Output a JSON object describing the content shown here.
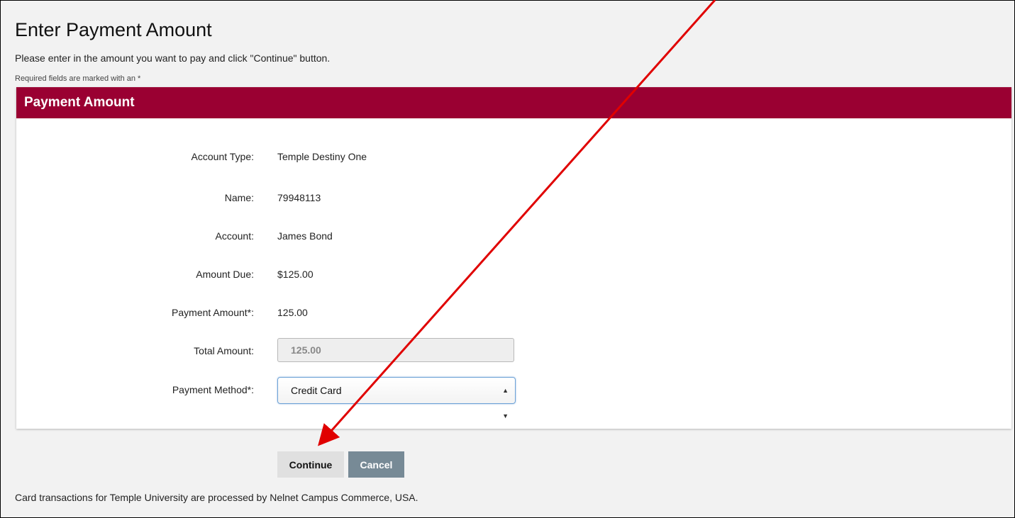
{
  "page": {
    "title": "Enter Payment Amount",
    "instructions": "Please enter in the amount you want to pay and click \"Continue\" button.",
    "required_note": "Required fields are marked with an *"
  },
  "panel": {
    "header": "Payment Amount",
    "fields": {
      "account_type": {
        "label": "Account Type:",
        "value": "Temple Destiny One"
      },
      "name": {
        "label": "Name:",
        "value": "79948113"
      },
      "account": {
        "label": "Account:",
        "value": "James Bond"
      },
      "amount_due": {
        "label": "Amount Due:",
        "value": "$125.00"
      },
      "payment_amount": {
        "label": "Payment Amount*:",
        "value": "125.00"
      },
      "total_amount": {
        "label": "Total Amount:",
        "value": "125.00"
      },
      "payment_method": {
        "label": "Payment Method*:",
        "selected": "Credit Card"
      }
    }
  },
  "buttons": {
    "continue_label": "Continue",
    "cancel_label": "Cancel"
  },
  "footer": {
    "note": "Card transactions for Temple University are processed by Nelnet Campus Commerce, USA."
  },
  "colors": {
    "header_bg": "#9a0032",
    "annotation_arrow": "#e00000",
    "cancel_bg": "#778a96"
  }
}
